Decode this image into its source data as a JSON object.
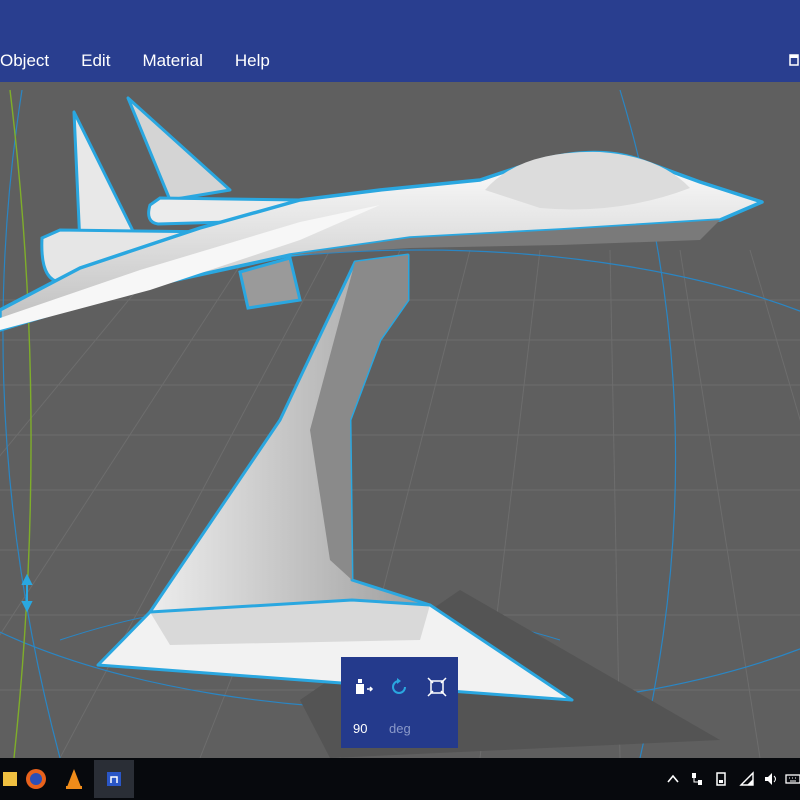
{
  "menu": {
    "items": [
      {
        "label": "Object"
      },
      {
        "label": "Edit"
      },
      {
        "label": "Material"
      },
      {
        "label": "Help"
      }
    ]
  },
  "rotate_panel": {
    "tools": [
      {
        "icon": "drop-to-floor-icon"
      },
      {
        "icon": "rotate-icon",
        "active": true
      },
      {
        "icon": "scale-icon"
      }
    ],
    "angle_value": "90",
    "angle_unit": "deg"
  },
  "taskbar": {
    "apps": [
      {
        "icon": "app-icon"
      },
      {
        "icon": "firefox-icon"
      },
      {
        "icon": "vlc-icon"
      },
      {
        "icon": "3d-builder-icon",
        "active": true
      }
    ],
    "tray": [
      {
        "icon": "chevron-up-icon"
      },
      {
        "icon": "network-icon"
      },
      {
        "icon": "storage-icon"
      },
      {
        "icon": "wifi-icon"
      },
      {
        "icon": "volume-icon"
      },
      {
        "icon": "keyboard-icon"
      }
    ]
  },
  "colors": {
    "titlebar": "#293e8f",
    "selection_outline": "#2aa7e0",
    "viewport_bg": "#5f5f5f",
    "taskbar": "#07090d",
    "panel": "#243a8c"
  }
}
